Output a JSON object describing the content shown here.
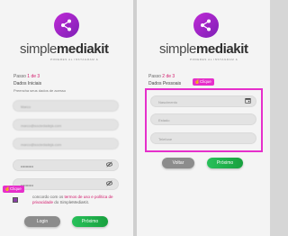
{
  "brand": {
    "light": "simple",
    "bold": "mediakit",
    "tagline": "PODERES AL INSTAGRAM &"
  },
  "colors": {
    "accent": "#d2196b",
    "highlight": "#e62fcb",
    "next_button": "#1fae48",
    "back_button": "#8c8c8c",
    "logo": "#a225c9"
  },
  "left": {
    "step_prefix": "Passo ",
    "step_num": "1 de 3",
    "title": "Dados Iniciais",
    "subtitle": "Preencha seus dados de acesso",
    "fields": [
      {
        "value": "Marco"
      },
      {
        "value": "marco@sociedadejá.com"
      },
      {
        "value": "marco@sociedadejá.com"
      },
      {
        "value": "••••••••••",
        "icon": "eye-slash-icon"
      },
      {
        "value": "••••••••••",
        "icon": "eye-slash-icon"
      }
    ],
    "consent_pre": "concordo com os ",
    "consent_link1": "termos de uso e política de",
    "consent_link2": "privacidade",
    "consent_post": " do SimpleMediaKit.",
    "clique": "Clique",
    "btn_login": "Login",
    "btn_next": "Próximo"
  },
  "right": {
    "step_prefix": "Passo ",
    "step_num": "2 de 3",
    "title": "Dados Pessoais",
    "clique": "Clique",
    "fields": [
      {
        "placeholder": "Nascimento",
        "icon": "calendar-icon"
      },
      {
        "placeholder": "Estado"
      },
      {
        "placeholder": "Telefone"
      }
    ],
    "btn_back": "Voltar",
    "btn_next": "Próximo"
  }
}
